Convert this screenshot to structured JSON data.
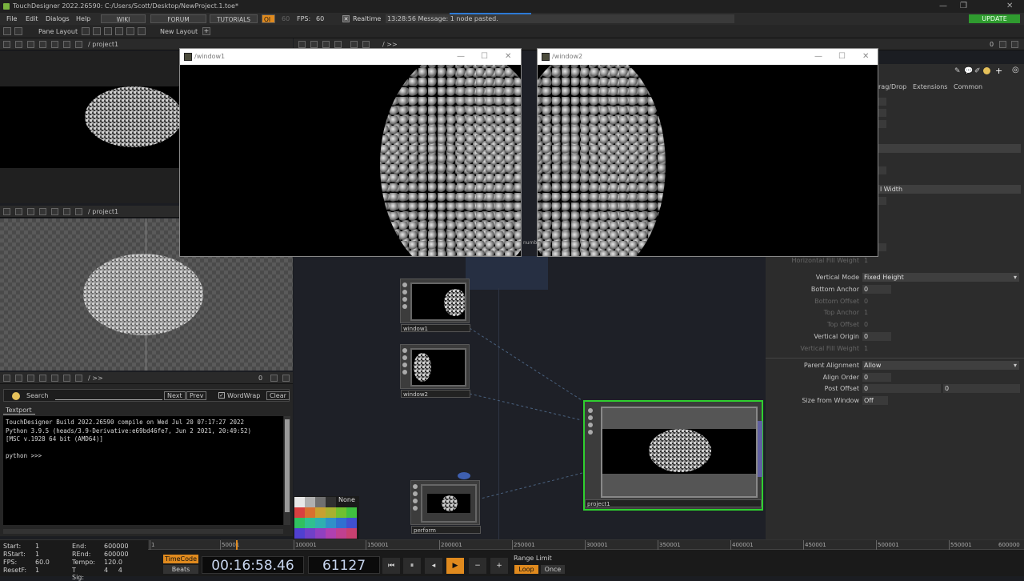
{
  "titlebar": {
    "title": "TouchDesigner 2022.26590: C:/Users/Scott/Desktop/NewProject.1.toe*"
  },
  "menu": {
    "items": [
      "File",
      "Edit",
      "Dialogs",
      "Help"
    ],
    "buttons": [
      "WIKI",
      "FORUM",
      "TUTORIALS"
    ],
    "perf_label": "OI",
    "fps_target": "60",
    "fps_label": "FPS:",
    "fps_value": "60",
    "realtime_label": "Realtime",
    "message": "13:28:56 Message: 1 node pasted.",
    "update_label": "UPDATE"
  },
  "toolbar": {
    "pane_layout_label": "Pane Layout",
    "new_layout_label": "New Layout"
  },
  "panes": {
    "top_path": "/ project1",
    "mid_path": "/ project1",
    "net_path": "/ >>",
    "bottom_path": "/ >>",
    "net_count": "0",
    "bottom_count": "0"
  },
  "windows": [
    {
      "title": "/window1"
    },
    {
      "title": "/window2"
    }
  ],
  "network": {
    "nodes": [
      {
        "label": "window1"
      },
      {
        "label": "window2"
      },
      {
        "label": "project1"
      },
      {
        "label": "perform"
      }
    ],
    "swatch_none": "None",
    "hidden_label": "numb"
  },
  "params": {
    "tabs": [
      "rag/Drop",
      "Extensions",
      "Common"
    ],
    "width_mode_fragment": "l Width",
    "rows": [
      {
        "label": "Horizontal Fill Weight",
        "value": "1",
        "dim": true
      },
      {
        "label": "Vertical Mode",
        "value": "Fixed Height",
        "type": "dropdown"
      },
      {
        "label": "Bottom Anchor",
        "value": "0"
      },
      {
        "label": "Bottom Offset",
        "value": "0",
        "dim": true
      },
      {
        "label": "Top Anchor",
        "value": "1",
        "dim": true
      },
      {
        "label": "Top Offset",
        "value": "0",
        "dim": true
      },
      {
        "label": "Vertical Origin",
        "value": "0"
      },
      {
        "label": "Vertical Fill Weight",
        "value": "1",
        "dim": true
      },
      {
        "label": "Parent Alignment",
        "value": "Allow",
        "type": "dropdown"
      },
      {
        "label": "Align Order",
        "value": "0"
      },
      {
        "label": "Post Offset",
        "value": "0",
        "value2": "0"
      },
      {
        "label": "Size from Window",
        "value": "Off"
      }
    ]
  },
  "textport": {
    "search_label": "Search",
    "next_label": "Next",
    "prev_label": "Prev",
    "wordwrap_label": "WordWrap",
    "clear_label": "Clear",
    "tab_label": "Textport",
    "lines": [
      "TouchDesigner  Build 2022.26590 compile on Wed Jul 20 07:17:27 2022",
      "Python 3.9.5 (heads/3.9-Derivative:e69bd46fe7, Jun  2 2021, 20:49:52)",
      "[MSC v.1928 64 bit (AMD64)]",
      "",
      "python >>>"
    ]
  },
  "timeline": {
    "ruler_ticks": [
      "1",
      "50001",
      "100001",
      "150001",
      "200001",
      "250001",
      "300001",
      "350001",
      "400001",
      "450001",
      "500001",
      "550001",
      "600000"
    ],
    "stats": [
      {
        "label": "Start:",
        "value": "1",
        "label2": "End:",
        "value2": "600000"
      },
      {
        "label": "RStart:",
        "value": "1",
        "label2": "REnd:",
        "value2": "600000"
      },
      {
        "label": "FPS:",
        "value": "60.0",
        "label2": "Tempo:",
        "value2": "120.0"
      },
      {
        "label": "ResetF:",
        "value": "1",
        "label2": "T Sig:",
        "value2": "4     4"
      }
    ],
    "timecode_label": "TimeCode",
    "beats_label": "Beats",
    "timecode": "00:16:58.46",
    "frame": "61127",
    "range_limit_label": "Range Limit",
    "loop_label": "Loop",
    "once_label": "Once"
  },
  "colors": {
    "accent_orange": "#e08a1e",
    "update_green": "#2f9b2f",
    "selected_node_border": "#2fcf2f"
  }
}
